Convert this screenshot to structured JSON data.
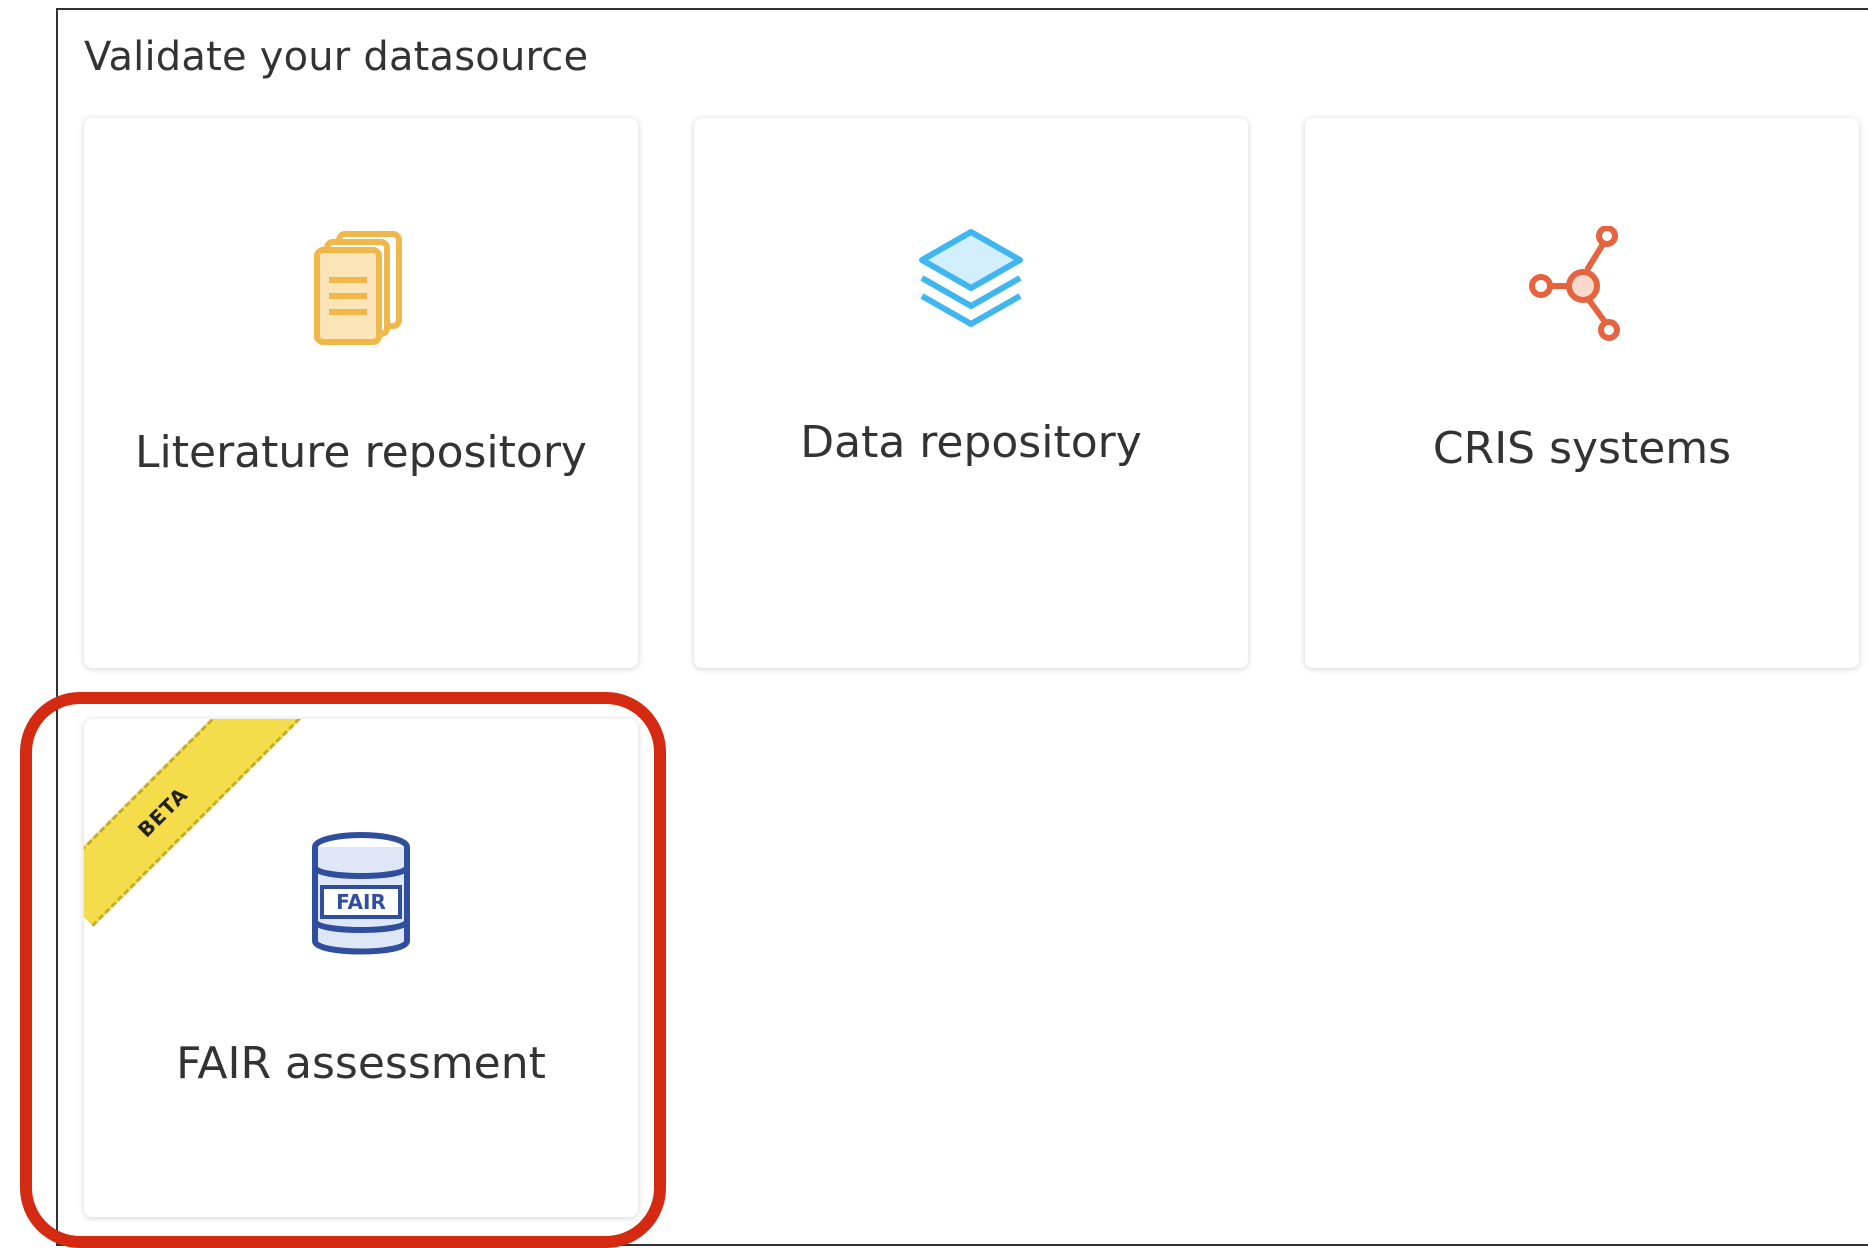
{
  "section": {
    "title": "Validate your datasource"
  },
  "cards": [
    {
      "label": "Literature repository",
      "icon": "documents-icon",
      "color": "#f0b84a"
    },
    {
      "label": "Data repository",
      "icon": "layers-icon",
      "color": "#3fb6ef"
    },
    {
      "label": "CRIS systems",
      "icon": "network-nodes-icon",
      "color": "#e5633e"
    },
    {
      "label": "FAIR assessment",
      "icon": "fair-database-icon",
      "color": "#2f4f9e",
      "badge": "BETA",
      "icon_text": "FAIR"
    }
  ],
  "highlight": {
    "color": "#d42a12"
  }
}
